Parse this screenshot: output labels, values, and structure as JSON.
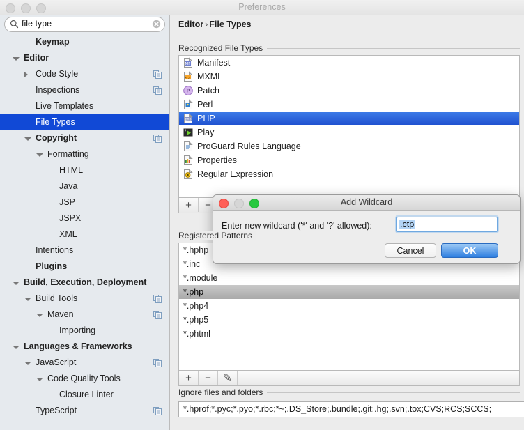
{
  "window": {
    "title": "Preferences",
    "traffic_lights": [
      "close",
      "minimize",
      "zoom"
    ]
  },
  "search": {
    "value": "file type",
    "placeholder": "",
    "icon": "search-icon",
    "clear_icon": "clear-circle-icon"
  },
  "sidebar": {
    "items": [
      {
        "label": "Keymap",
        "indent": 1,
        "bold": true,
        "twisty": "none",
        "copy": false,
        "selected": false
      },
      {
        "label": "Editor",
        "indent": 0,
        "bold": true,
        "twisty": "open",
        "copy": false,
        "selected": false
      },
      {
        "label": "Code Style",
        "indent": 1,
        "bold": false,
        "twisty": "closed",
        "copy": true,
        "selected": false
      },
      {
        "label": "Inspections",
        "indent": 1,
        "bold": false,
        "twisty": "none",
        "copy": true,
        "selected": false
      },
      {
        "label": "Live Templates",
        "indent": 1,
        "bold": false,
        "twisty": "none",
        "copy": false,
        "selected": false
      },
      {
        "label": "File Types",
        "indent": 1,
        "bold": false,
        "twisty": "none",
        "copy": false,
        "selected": true
      },
      {
        "label": "Copyright",
        "indent": 1,
        "bold": true,
        "twisty": "open",
        "copy": true,
        "selected": false
      },
      {
        "label": "Formatting",
        "indent": 2,
        "bold": false,
        "twisty": "open",
        "copy": false,
        "selected": false
      },
      {
        "label": "HTML",
        "indent": 3,
        "bold": false,
        "twisty": "none",
        "copy": false,
        "selected": false
      },
      {
        "label": "Java",
        "indent": 3,
        "bold": false,
        "twisty": "none",
        "copy": false,
        "selected": false
      },
      {
        "label": "JSP",
        "indent": 3,
        "bold": false,
        "twisty": "none",
        "copy": false,
        "selected": false
      },
      {
        "label": "JSPX",
        "indent": 3,
        "bold": false,
        "twisty": "none",
        "copy": false,
        "selected": false
      },
      {
        "label": "XML",
        "indent": 3,
        "bold": false,
        "twisty": "none",
        "copy": false,
        "selected": false
      },
      {
        "label": "Intentions",
        "indent": 1,
        "bold": false,
        "twisty": "none",
        "copy": false,
        "selected": false
      },
      {
        "label": "Plugins",
        "indent": 1,
        "bold": true,
        "twisty": "none",
        "copy": false,
        "selected": false
      },
      {
        "label": "Build, Execution, Deployment",
        "indent": 0,
        "bold": true,
        "twisty": "open",
        "copy": false,
        "selected": false
      },
      {
        "label": "Build Tools",
        "indent": 1,
        "bold": false,
        "twisty": "open",
        "copy": true,
        "selected": false
      },
      {
        "label": "Maven",
        "indent": 2,
        "bold": false,
        "twisty": "open",
        "copy": true,
        "selected": false
      },
      {
        "label": "Importing",
        "indent": 3,
        "bold": false,
        "twisty": "none",
        "copy": false,
        "selected": false
      },
      {
        "label": "Languages & Frameworks",
        "indent": 0,
        "bold": true,
        "twisty": "open",
        "copy": false,
        "selected": false
      },
      {
        "label": "JavaScript",
        "indent": 1,
        "bold": false,
        "twisty": "open",
        "copy": true,
        "selected": false
      },
      {
        "label": "Code Quality Tools",
        "indent": 2,
        "bold": false,
        "twisty": "open",
        "copy": false,
        "selected": false
      },
      {
        "label": "Closure Linter",
        "indent": 3,
        "bold": false,
        "twisty": "none",
        "copy": false,
        "selected": false
      },
      {
        "label": "TypeScript",
        "indent": 1,
        "bold": false,
        "twisty": "none",
        "copy": true,
        "selected": false
      }
    ]
  },
  "main": {
    "breadcrumb": {
      "root": "Editor",
      "separator": "›",
      "leaf": "File Types"
    },
    "recognized": {
      "group_label": "Recognized File Types",
      "rows": [
        {
          "label": "Manifest",
          "icon": "manifest-file-icon",
          "selected": false
        },
        {
          "label": "MXML",
          "icon": "mxml-file-icon",
          "selected": false
        },
        {
          "label": "Patch",
          "icon": "patch-file-icon",
          "selected": false
        },
        {
          "label": "Perl",
          "icon": "perl-file-icon",
          "selected": false
        },
        {
          "label": "PHP",
          "icon": "php-file-icon",
          "selected": true
        },
        {
          "label": "Play",
          "icon": "play-file-icon",
          "selected": false
        },
        {
          "label": "ProGuard Rules Language",
          "icon": "proguard-file-icon",
          "selected": false
        },
        {
          "label": "Properties",
          "icon": "properties-file-icon",
          "selected": false
        },
        {
          "label": "Regular Expression",
          "icon": "regex-file-icon",
          "selected": false
        }
      ],
      "toolbar": {
        "add": "+",
        "remove": "−",
        "edit": "✎"
      }
    },
    "registered": {
      "group_label": "Registered Patterns",
      "rows": [
        {
          "label": "*.hphp",
          "selected": false
        },
        {
          "label": "*.inc",
          "selected": false
        },
        {
          "label": "*.module",
          "selected": false
        },
        {
          "label": "*.php",
          "selected": true
        },
        {
          "label": "*.php4",
          "selected": false
        },
        {
          "label": "*.php5",
          "selected": false
        },
        {
          "label": "*.phtml",
          "selected": false
        }
      ],
      "toolbar": {
        "add": "+",
        "remove": "−",
        "edit": "✎"
      }
    },
    "ignore": {
      "group_label": "Ignore files and folders",
      "value": "*.hprof;*.pyc;*.pyo;*.rbc;*~;.DS_Store;.bundle;.git;.hg;.svn;.tox;CVS;RCS;SCCS;"
    }
  },
  "dialog": {
    "title": "Add Wildcard",
    "prompt": "Enter new wildcard ('*' and '?' allowed):",
    "input_value": ".ctp",
    "cancel_label": "Cancel",
    "ok_label": "OK"
  },
  "colors": {
    "selection_blue": "#1149d6",
    "list_selection_blue": "#2f66da",
    "ok_button_blue": "#2f7fe0",
    "window_chrome": "#ececec",
    "sidebar_bg": "#e6eaee"
  }
}
